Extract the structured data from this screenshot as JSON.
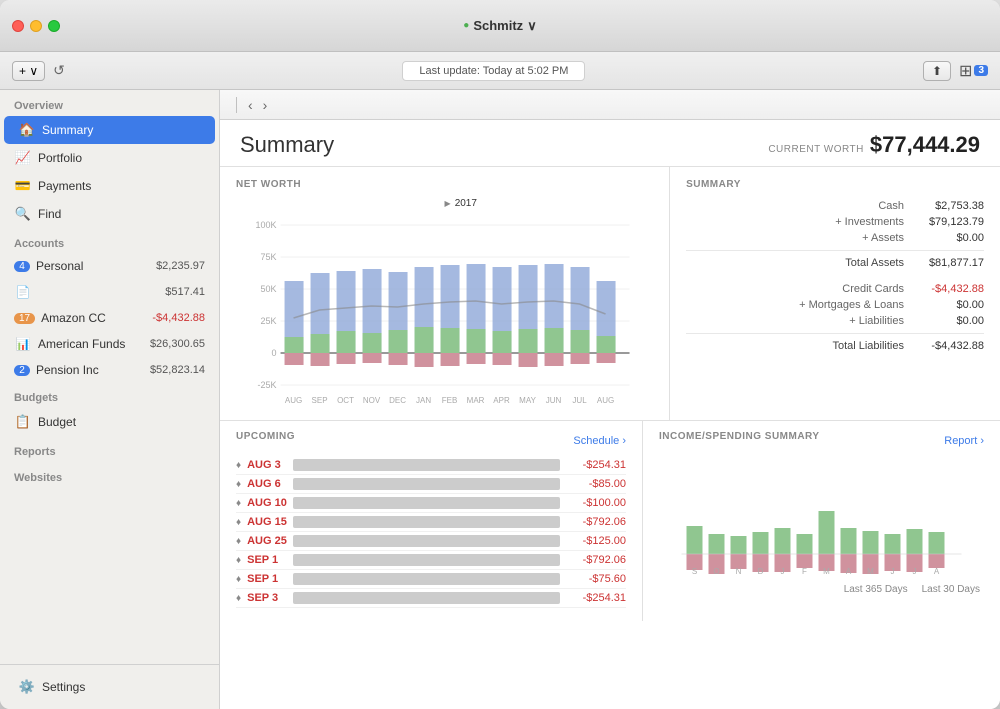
{
  "window": {
    "title": "Schmitz",
    "traffic_lights": [
      "close",
      "minimize",
      "maximize"
    ]
  },
  "titlebar": {
    "app_name": "Schmitz",
    "dot_color": "#28c940",
    "dropdown_arrow": "∨"
  },
  "toolbar": {
    "add_label": "+ ∨",
    "refresh_icon": "↺",
    "update_text": "Last update:  Today at 5:02 PM",
    "export_icon": "⬆",
    "badge": "3"
  },
  "sidebar": {
    "overview_label": "Overview",
    "items": [
      {
        "id": "summary",
        "label": "Summary",
        "icon": "🏠",
        "active": true
      },
      {
        "id": "portfolio",
        "label": "Portfolio",
        "icon": "📈"
      },
      {
        "id": "payments",
        "label": "Payments",
        "icon": "💳"
      },
      {
        "id": "find",
        "label": "Find",
        "icon": "🔍"
      }
    ],
    "accounts_label": "Accounts",
    "accounts": [
      {
        "id": "personal",
        "label": "Personal",
        "badge": "4",
        "badge_color": "blue",
        "value": "$2,235.97",
        "icon": "👤"
      },
      {
        "id": "unknown1",
        "label": "",
        "badge": "",
        "badge_color": "",
        "value": "$517.41",
        "icon": "📄"
      },
      {
        "id": "amazon",
        "label": "Amazon CC",
        "badge": "17",
        "badge_color": "orange",
        "value": "-$4,432.88",
        "icon": "💳"
      },
      {
        "id": "american-funds",
        "label": "American Funds",
        "badge": "",
        "badge_color": "",
        "value": "$26,300.65",
        "icon": "📊"
      },
      {
        "id": "pension",
        "label": "Pension Inc",
        "badge": "2",
        "badge_color": "blue",
        "value": "$52,823.14",
        "icon": "🏦"
      }
    ],
    "budgets_label": "Budgets",
    "budgets": [
      {
        "id": "budget",
        "label": "Budget",
        "icon": "📋"
      }
    ],
    "reports_label": "Reports",
    "websites_label": "Websites",
    "settings_label": "Settings"
  },
  "content_nav": {
    "back": "‹",
    "forward": "›"
  },
  "summary": {
    "title": "Summary",
    "current_worth_label": "CURRENT WORTH",
    "current_worth_value": "$77,444.29"
  },
  "net_worth": {
    "section_label": "NET WORTH",
    "year_label": "2017",
    "y_labels": [
      "100K",
      "75K",
      "50K",
      "25K",
      "0",
      "-25K"
    ],
    "x_labels": [
      "AUG",
      "SEP",
      "OCT",
      "NOV",
      "DEC",
      "JAN",
      "FEB",
      "MAR",
      "APR",
      "MAY",
      "JUN",
      "JUL",
      "AUG"
    ],
    "bars": [
      {
        "blue": 55,
        "green": 12,
        "pink": 8
      },
      {
        "blue": 60,
        "green": 14,
        "pink": 10
      },
      {
        "blue": 62,
        "green": 15,
        "pink": 9
      },
      {
        "blue": 64,
        "green": 14,
        "pink": 8
      },
      {
        "blue": 63,
        "green": 16,
        "pink": 9
      },
      {
        "blue": 65,
        "green": 18,
        "pink": 10
      },
      {
        "blue": 66,
        "green": 17,
        "pink": 9
      },
      {
        "blue": 67,
        "green": 16,
        "pink": 8
      },
      {
        "blue": 65,
        "green": 15,
        "pink": 9
      },
      {
        "blue": 66,
        "green": 16,
        "pink": 10
      },
      {
        "blue": 67,
        "green": 17,
        "pink": 9
      },
      {
        "blue": 65,
        "green": 16,
        "pink": 8
      },
      {
        "blue": 55,
        "green": 14,
        "pink": 7
      }
    ]
  },
  "summary_panel": {
    "section_label": "SUMMARY",
    "rows": [
      {
        "label": "Cash",
        "value": "$2,753.38",
        "type": "normal"
      },
      {
        "label": "+ Investments",
        "value": "$79,123.79",
        "type": "normal"
      },
      {
        "label": "+ Assets",
        "value": "$0.00",
        "type": "normal"
      },
      {
        "label": "Total Assets",
        "value": "$81,877.17",
        "type": "total"
      },
      {
        "label": "Credit Cards",
        "value": "-$4,432.88",
        "type": "negative"
      },
      {
        "label": "+ Mortgages & Loans",
        "value": "$0.00",
        "type": "normal"
      },
      {
        "label": "+ Liabilities",
        "value": "$0.00",
        "type": "normal"
      },
      {
        "label": "Total Liabilities",
        "value": "-$4,432.88",
        "type": "total-negative"
      }
    ]
  },
  "upcoming": {
    "section_label": "UPCOMING",
    "schedule_link": "Schedule ›",
    "rows": [
      {
        "date": "AUG 3",
        "desc": "blurred",
        "amount": "-$254.31"
      },
      {
        "date": "AUG 6",
        "desc": "blurred",
        "amount": "-$85.00"
      },
      {
        "date": "AUG 10",
        "desc": "blurred",
        "amount": "-$100.00"
      },
      {
        "date": "AUG 15",
        "desc": "blurred",
        "amount": "-$792.06"
      },
      {
        "date": "AUG 25",
        "desc": "blurred",
        "amount": "-$125.00"
      },
      {
        "date": "SEP 1",
        "desc": "blurred",
        "amount": "-$792.06"
      },
      {
        "date": "SEP 1",
        "desc": "blurred",
        "amount": "-$75.60"
      },
      {
        "date": "SEP 3",
        "desc": "blurred",
        "amount": "-$254.31"
      }
    ]
  },
  "income": {
    "section_label": "INCOME/SPENDING SUMMARY",
    "report_link": "Report ›",
    "x_labels": [
      "S",
      "O",
      "N",
      "D",
      "J",
      "F",
      "M",
      "A",
      "M",
      "J",
      "J",
      "A"
    ],
    "bars": [
      {
        "green": 30,
        "pink": 20
      },
      {
        "green": 20,
        "pink": 25
      },
      {
        "green": 15,
        "pink": 18
      },
      {
        "green": 22,
        "pink": 20
      },
      {
        "green": 25,
        "pink": 22
      },
      {
        "green": 20,
        "pink": 18
      },
      {
        "green": 45,
        "pink": 20
      },
      {
        "green": 28,
        "pink": 22
      },
      {
        "green": 22,
        "pink": 25
      },
      {
        "green": 20,
        "pink": 20
      },
      {
        "green": 25,
        "pink": 22
      },
      {
        "green": 22,
        "pink": 18
      }
    ],
    "period_btns": [
      "Last 365 Days",
      "Last 30 Days"
    ]
  }
}
